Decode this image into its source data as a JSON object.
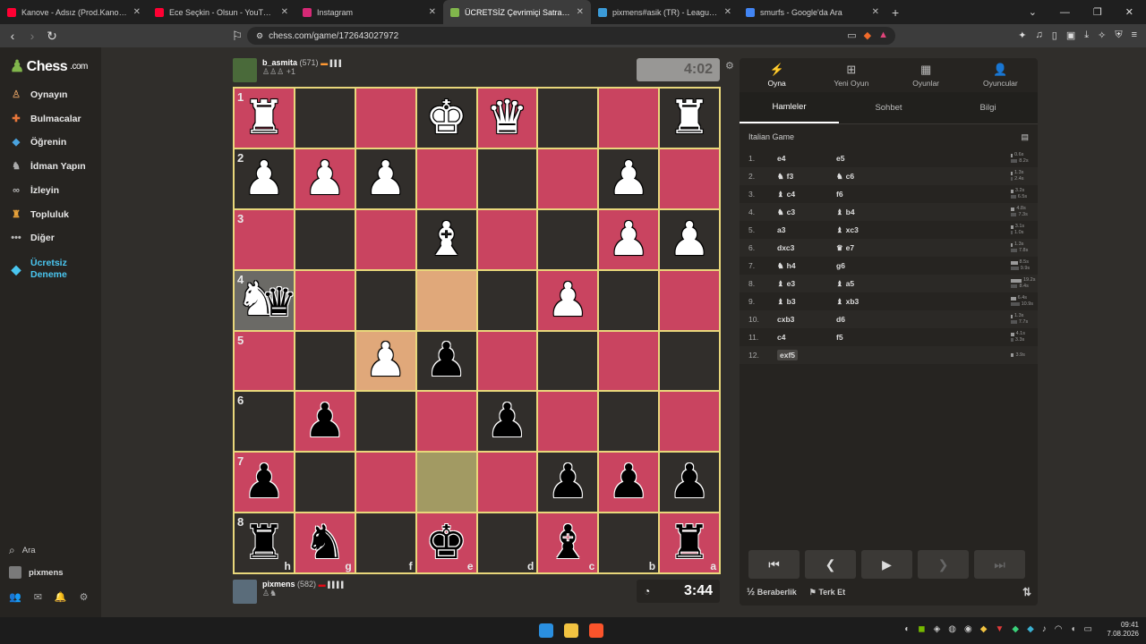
{
  "browser": {
    "tabs": [
      {
        "title": "Kanove - Adsız (Prod.Kanove) - YouTube",
        "icon": "youtube-icon",
        "color": "#ff0033",
        "active": false
      },
      {
        "title": "Ece Seçkin - Olsun - YouTube",
        "icon": "youtube-icon",
        "color": "#ff0033",
        "active": false
      },
      {
        "title": "Instagram",
        "icon": "instagram-icon",
        "color": "#d62976",
        "active": false
      },
      {
        "title": "ÜCRETSİZ Çevrimiçi Satranç O",
        "icon": "chess-icon",
        "color": "#81b64c",
        "active": true
      },
      {
        "title": "pixmens#asik (TR) - LeagueOfGraphs",
        "icon": "leagueofgraphs-icon",
        "color": "#3b9bd8",
        "active": false
      },
      {
        "title": "smurfs - Google'da Ara",
        "icon": "google-icon",
        "color": "#4285f4",
        "active": false
      }
    ],
    "url": "chess.com/game/172643027972"
  },
  "sidebar": {
    "logo": "Chess",
    "logo_suffix": ".com",
    "items": [
      {
        "label": "Oynayın",
        "icon": "play-icon",
        "color": "#c88f5a"
      },
      {
        "label": "Bulmacalar",
        "icon": "puzzle-icon",
        "color": "#e8763a"
      },
      {
        "label": "Öğrenin",
        "icon": "learn-icon",
        "color": "#4aa3df"
      },
      {
        "label": "İdman Yapın",
        "icon": "train-icon",
        "color": "#aaaaaa"
      },
      {
        "label": "İzleyin",
        "icon": "watch-icon",
        "color": "#b7b7b7"
      },
      {
        "label": "Topluluk",
        "icon": "community-icon",
        "color": "#e8a23a"
      },
      {
        "label": "Diğer",
        "icon": "more-icon",
        "color": "#bbbbbb"
      }
    ],
    "trial_line1": "Ücretsiz",
    "trial_line2": "Deneme",
    "search_label": "Ara",
    "username": "pixmens"
  },
  "top_player": {
    "name": "b_asmita",
    "rating": "(571)",
    "captured": "♙♙♙",
    "advantage": "+1"
  },
  "bottom_player": {
    "name": "pixmens",
    "rating": "(582)",
    "captured": "♙♞"
  },
  "clocks": {
    "top": "4:02",
    "bottom": "3:44"
  },
  "board": {
    "rank_labels": [
      "1",
      "2",
      "3",
      "4",
      "5",
      "6",
      "7",
      "8"
    ],
    "file_labels": [
      "h",
      "g",
      "f",
      "e",
      "d",
      "c",
      "b",
      "a"
    ],
    "pieces": [
      [
        "♜w",
        "",
        "",
        "♚w",
        "♛w",
        "",
        "",
        "♜w"
      ],
      [
        "♟w",
        "♟w",
        "♟w",
        "",
        "",
        "",
        "♟w",
        ""
      ],
      [
        "",
        "",
        "",
        "♝w",
        "",
        "",
        "♟w",
        "♟w"
      ],
      [
        "♞w♛b",
        "",
        "",
        "",
        "",
        "♟w",
        "",
        ""
      ],
      [
        "",
        "",
        "♟w",
        "♟b",
        "",
        "",
        "",
        ""
      ],
      [
        "",
        "♟b",
        "",
        "",
        "♟b",
        "",
        "",
        ""
      ],
      [
        "♟b",
        "",
        "",
        "",
        "",
        "♟b",
        "♟b",
        "♟b"
      ],
      [
        "♜b",
        "♞b",
        "",
        "♚b",
        "",
        "♝b",
        "",
        "♜b"
      ]
    ]
  },
  "panel": {
    "tabs": [
      {
        "label": "Oyna",
        "icon": "bolt-icon"
      },
      {
        "label": "Yeni Oyun",
        "icon": "plus-icon"
      },
      {
        "label": "Oyunlar",
        "icon": "board-icon"
      },
      {
        "label": "Oyuncular",
        "icon": "players-icon"
      }
    ],
    "subtabs": [
      "Hamleler",
      "Sohbet",
      "Bilgi"
    ],
    "opening": "Italian Game",
    "moves": [
      {
        "n": "1.",
        "w": "e4",
        "b": "e5",
        "wp": "",
        "bp": "",
        "tw": "0.6s",
        "tb": "8.2s",
        "fw": 0.05,
        "fb": 0.6
      },
      {
        "n": "2.",
        "w": "f3",
        "b": "c6",
        "wp": "♞",
        "bp": "♞",
        "tw": "1.3s",
        "tb": "2.4s",
        "fw": 0.1,
        "fb": 0.18
      },
      {
        "n": "3.",
        "w": "c4",
        "b": "f6",
        "wp": "♝",
        "bp": "",
        "tw": "3.2s",
        "tb": "6.5s",
        "fw": 0.24,
        "fb": 0.48
      },
      {
        "n": "4.",
        "w": "c3",
        "b": "b4",
        "wp": "♞",
        "bp": "♝",
        "tw": "4.8s",
        "tb": "7.3s",
        "fw": 0.36,
        "fb": 0.54
      },
      {
        "n": "5.",
        "w": "a3",
        "b": "xc3",
        "wp": "",
        "bp": "♝",
        "tw": "3.1s",
        "tb": "1.0s",
        "fw": 0.23,
        "fb": 0.08
      },
      {
        "n": "6.",
        "w": "dxc3",
        "b": "e7",
        "wp": "",
        "bp": "♛",
        "tw": "1.3s",
        "tb": "7.8s",
        "fw": 0.1,
        "fb": 0.58
      },
      {
        "n": "7.",
        "w": "h4",
        "b": "g6",
        "wp": "♞",
        "bp": "",
        "tw": "8.5s",
        "tb": "9.9s",
        "fw": 0.63,
        "fb": 0.73
      },
      {
        "n": "8.",
        "w": "e3",
        "b": "a5",
        "wp": "♝",
        "bp": "♝",
        "tw": "19.2s",
        "tb": "8.4s",
        "fw": 1.0,
        "fb": 0.62
      },
      {
        "n": "9.",
        "w": "b3",
        "b": "xb3",
        "wp": "♝",
        "bp": "♝",
        "tw": "6.4s",
        "tb": "10.9s",
        "fw": 0.47,
        "fb": 0.8
      },
      {
        "n": "10.",
        "w": "cxb3",
        "b": "d6",
        "wp": "",
        "bp": "",
        "tw": "1.3s",
        "tb": "7.7s",
        "fw": 0.1,
        "fb": 0.57
      },
      {
        "n": "11.",
        "w": "c4",
        "b": "f5",
        "wp": "",
        "bp": "",
        "tw": "4.1s",
        "tb": "3.3s",
        "fw": 0.3,
        "fb": 0.24
      },
      {
        "n": "12.",
        "w": "exf5",
        "b": "",
        "wp": "",
        "bp": "",
        "tw": "3.9s",
        "tb": "",
        "fw": 0.29,
        "fb": 0
      }
    ],
    "draw_label": "Beraberlik",
    "draw_prefix": "½",
    "resign_label": "Terk Et"
  },
  "taskbar": {
    "time": "09:41",
    "date": "7.08.2026"
  }
}
